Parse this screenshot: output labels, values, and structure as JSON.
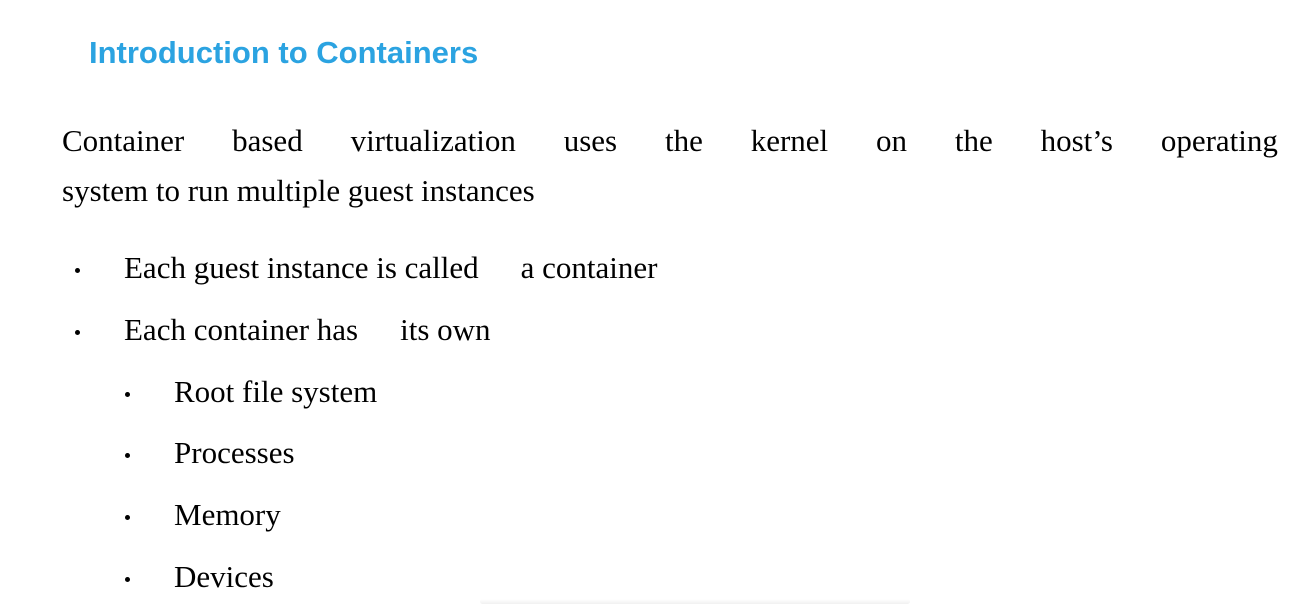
{
  "title": "Introduction to Containers",
  "intro": {
    "line1_words": [
      "Container",
      "based",
      "virtualization",
      "uses",
      "the",
      "kernel",
      "on",
      "the",
      "host’s",
      "operating"
    ],
    "line2": "system to run multiple guest instances"
  },
  "bullets": [
    {
      "part1": "Each guest instance is called",
      "part2": "a container"
    },
    {
      "part1": "Each container has",
      "part2": "its own"
    }
  ],
  "sub_bullets": [
    "Root file system",
    "Processes",
    "Memory",
    "Devices"
  ],
  "colors": {
    "title": "#2ba3e1",
    "text": "#000000",
    "background": "#ffffff"
  }
}
